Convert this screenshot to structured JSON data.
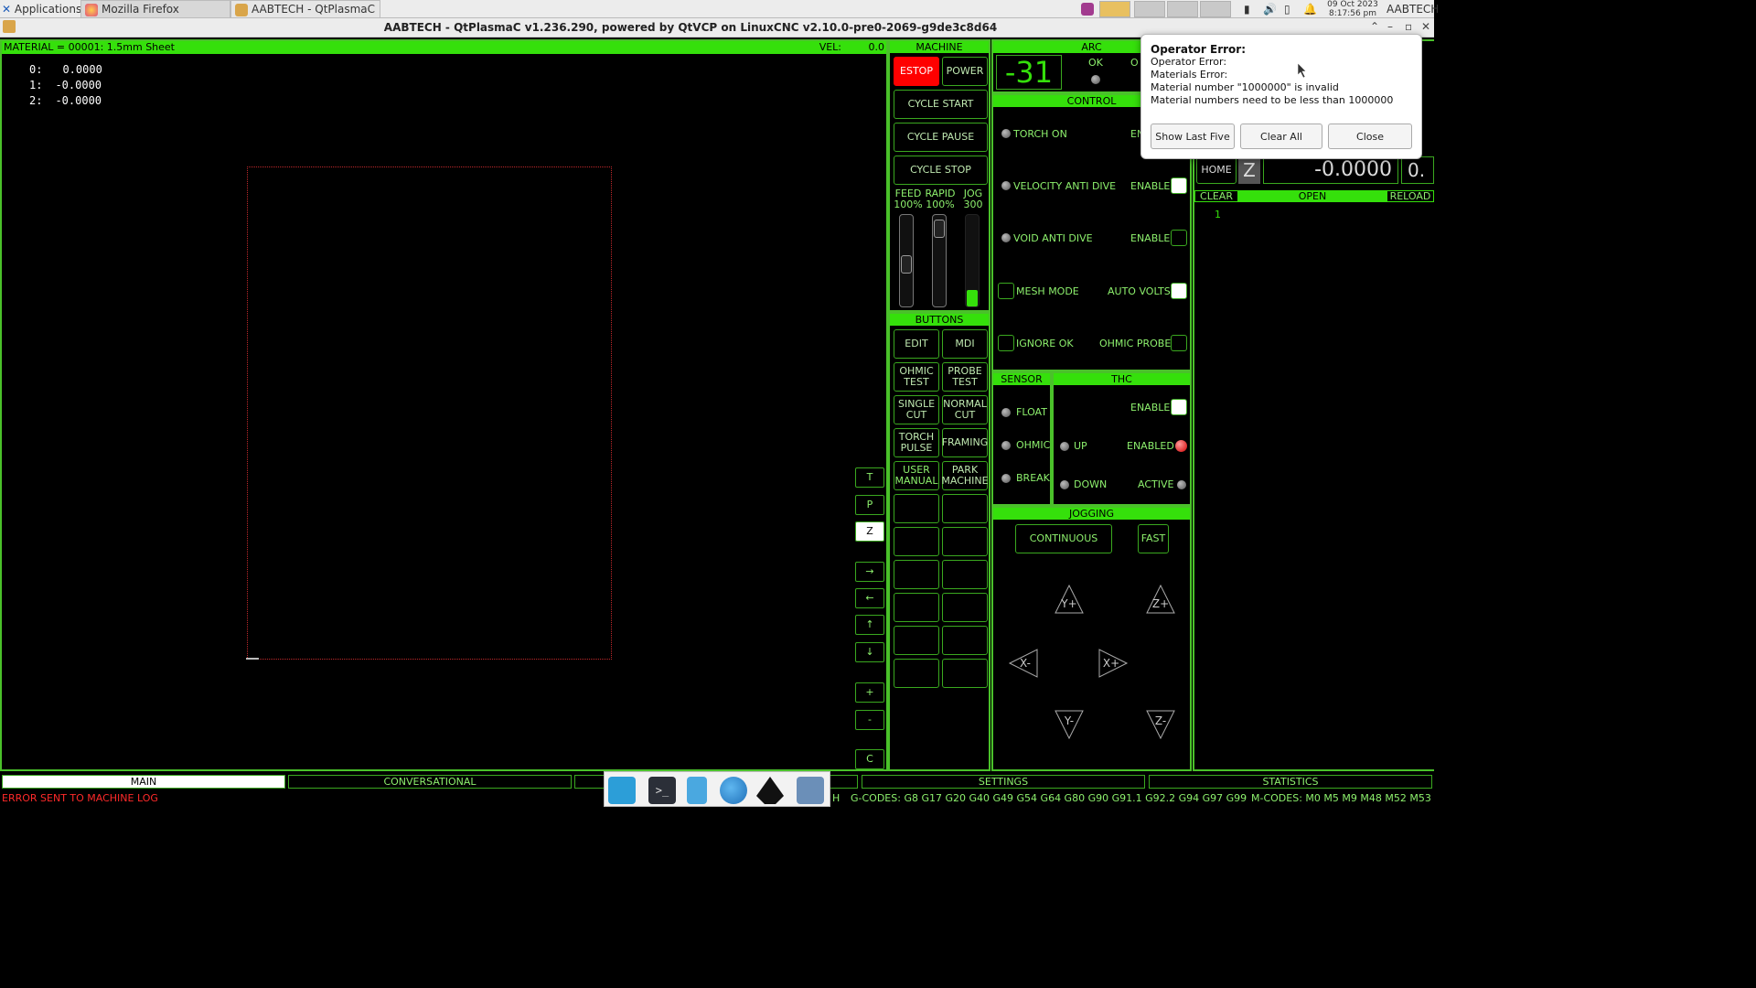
{
  "taskbar": {
    "applications_label": "Applications",
    "tabs": [
      {
        "label": "Mozilla Firefox"
      },
      {
        "label": "AABTECH - QtPlasmaC ..."
      }
    ],
    "date": "09 Oct 2023",
    "time": "8:17:56 pm",
    "user": "AABTECH"
  },
  "window": {
    "title": "AABTECH - QtPlasmaC v1.236.290, powered by QtVCP on LinuxCNC v2.10.0-pre0-2069-g9de3c8d64"
  },
  "preview": {
    "material": "MATERIAL = 00001: 1.5mm Sheet",
    "vel_label": "VEL:",
    "vel_value": "0.0",
    "dro": [
      {
        "axis": "0:",
        "value": "0.0000"
      },
      {
        "axis": "1:",
        "value": "-0.0000"
      },
      {
        "axis": "2:",
        "value": "-0.0000"
      }
    ],
    "side_buttons": [
      "T",
      "P",
      "Z",
      "→",
      "←",
      "↑",
      "↓",
      "+",
      "-",
      "C"
    ]
  },
  "machine": {
    "header": "MACHINE",
    "estop": "ESTOP",
    "power": "POWER",
    "cycle_start": "CYCLE START",
    "cycle_pause": "CYCLE PAUSE",
    "cycle_stop": "CYCLE STOP",
    "feed_label": "FEED",
    "feed_value": "100%",
    "rapid_label": "RAPID",
    "rapid_value": "100%",
    "jog_label": "JOG",
    "jog_value": "300",
    "feed_level": 0.45,
    "rapid_level": 0.95,
    "jog_level": 0.18
  },
  "buttons": {
    "header": "BUTTONS",
    "items": [
      "EDIT",
      "MDI",
      "OHMIC\nTEST",
      "PROBE\nTEST",
      "SINGLE\nCUT",
      "NORMAL\nCUT",
      "TORCH\nPULSE",
      "FRAMING",
      "USER\nMANUAL",
      "PARK\nMACHINE"
    ]
  },
  "arc": {
    "header": "ARC",
    "value": "-31",
    "ok_label": "OK",
    "partial_label": "O"
  },
  "control": {
    "header": "CONTROL",
    "torch_on": "TORCH ON",
    "torch_enable": "EN",
    "vad": "VELOCITY ANTI DIVE",
    "vad_enable": "ENABLE",
    "void": "VOID ANTI DIVE",
    "void_enable": "ENABLE",
    "mesh_mode": "MESH MODE",
    "auto_volts": "AUTO VOLTS",
    "ignore_ok": "IGNORE OK",
    "ohmic_probe": "OHMIC PROBE"
  },
  "sensor": {
    "header": "SENSOR",
    "float": "FLOAT",
    "ohmic": "OHMIC",
    "break": "BREAK"
  },
  "thc": {
    "header": "THC",
    "enable": "ENABLE",
    "up": "UP",
    "enabled": "ENABLED",
    "down": "DOWN",
    "active": "ACTIVE"
  },
  "jogging": {
    "header": "JOGGING",
    "continuous": "CONTINUOUS",
    "fast": "FAST",
    "y_plus": "Y+",
    "z_plus": "Z+",
    "x_minus": "X-",
    "x_plus": "X+",
    "y_minus": "Y-",
    "z_minus": "Z-"
  },
  "axis_dro": {
    "home": "HOME",
    "axis": "Z",
    "value": "-0.0000",
    "extra": "0."
  },
  "gcode": {
    "clear": "CLEAR",
    "open": "OPEN",
    "reload": "RELOAD",
    "line_number": "1"
  },
  "bottom_tabs": [
    "MAIN",
    "CONVERSATIONAL",
    "SETTINGS",
    "STATISTICS"
  ],
  "status": {
    "error": "ERROR SENT TO MACHINE LOG",
    "partial": "H",
    "gcodes": "G-CODES:  G8 G17 G20 G40 G49 G54 G64 G80 G90 G91.1 G92.2 G94 G97 G99",
    "mcodes": "M-CODES:  M0 M5 M9 M48 M52 M53"
  },
  "popup": {
    "title": "Operator Error:",
    "lines": [
      "Operator Error:",
      "Materials Error:",
      "Material number \"1000000\" is invalid",
      "Material numbers need to be less than 1000000"
    ],
    "show_last_five": "Show Last Five",
    "clear_all": "Clear All",
    "close": "Close"
  },
  "colors": {
    "accent_green": "#35e00b",
    "border_green": "#4ac12a",
    "estop_red": "#ff0000",
    "error_red": "#ff2a2a"
  }
}
